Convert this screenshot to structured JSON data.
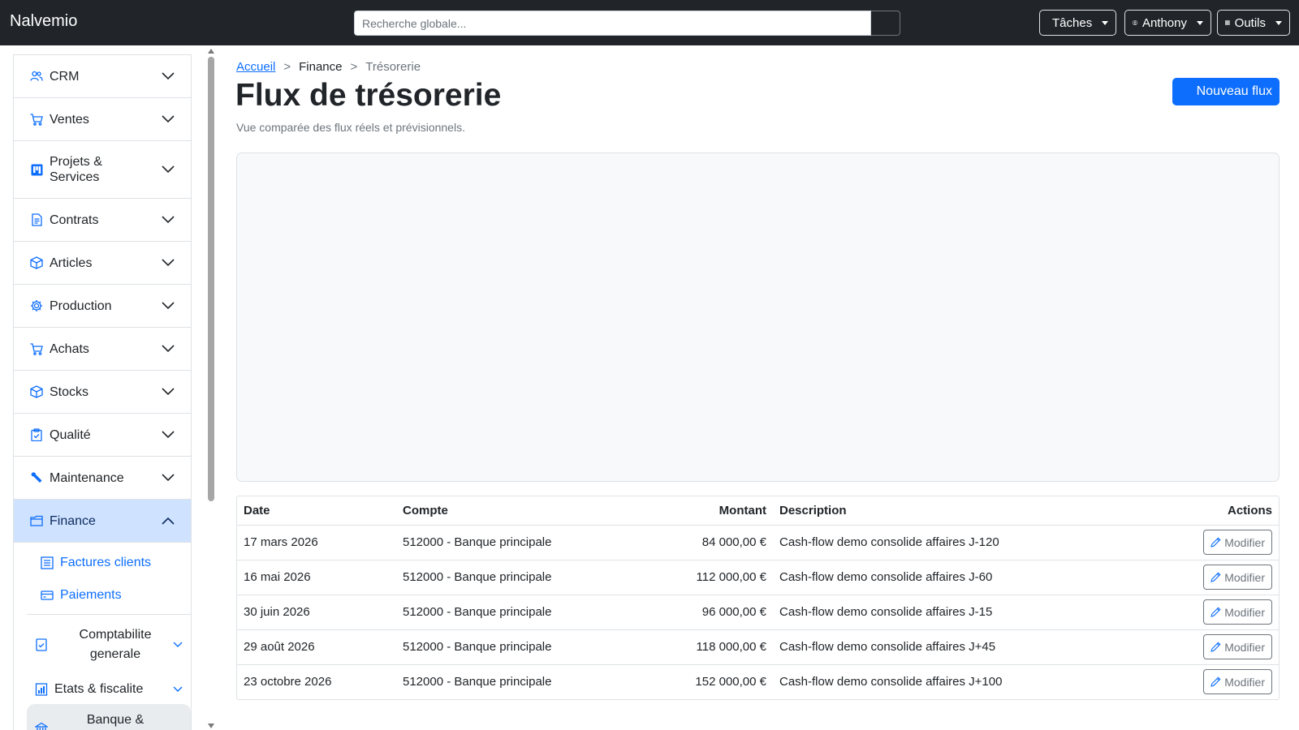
{
  "app": {
    "brand": "Nalvemio"
  },
  "search": {
    "placeholder": "Recherche globale..."
  },
  "topnav": {
    "tasks": {
      "label": "Tâches",
      "icon": "list-icon"
    },
    "user": {
      "label": "Anthony",
      "icon": "user-circle-icon"
    },
    "tools": {
      "label": "Outils",
      "icon": "grid-icon"
    }
  },
  "sidebar": {
    "items": [
      {
        "label": "CRM",
        "icon": "people-icon"
      },
      {
        "label": "Ventes",
        "icon": "cart-icon"
      },
      {
        "label": "Projets & Services",
        "icon": "kanban-icon"
      },
      {
        "label": "Contrats",
        "icon": "document-icon"
      },
      {
        "label": "Articles",
        "icon": "box-icon"
      },
      {
        "label": "Production",
        "icon": "gear-icon"
      },
      {
        "label": "Achats",
        "icon": "cart-icon"
      },
      {
        "label": "Stocks",
        "icon": "box-icon"
      },
      {
        "label": "Qualité",
        "icon": "clipboard-check-icon"
      },
      {
        "label": "Maintenance",
        "icon": "wrench-icon"
      },
      {
        "label": "Finance",
        "icon": "folder-icon"
      }
    ],
    "finance_sub": [
      {
        "label": "Factures clients",
        "icon": "list-icon"
      },
      {
        "label": "Paiements",
        "icon": "credit-card-icon"
      }
    ],
    "finance_groups": [
      {
        "label": "Comptabilite generale",
        "icon": "journal-check-icon"
      },
      {
        "label": "Etats & fiscalite",
        "icon": "bar-chart-icon"
      },
      {
        "label": "Banque &",
        "icon": "bank-icon"
      }
    ]
  },
  "breadcrumb": {
    "home": "Accueil",
    "section": "Finance",
    "current": "Trésorerie",
    "separator": ">"
  },
  "page": {
    "title": "Flux de trésorerie",
    "subtitle": "Vue comparée des flux réels et prévisionnels.",
    "new_button": "Nouveau flux"
  },
  "table": {
    "headers": {
      "date": "Date",
      "account": "Compte",
      "amount": "Montant",
      "description": "Description",
      "actions": "Actions"
    },
    "edit_label": "Modifier",
    "rows": [
      {
        "date": "17 mars 2026",
        "account": "512000 - Banque principale",
        "amount": "84 000,00 €",
        "description": "Cash-flow demo consolide affaires J-120"
      },
      {
        "date": "16 mai 2026",
        "account": "512000 - Banque principale",
        "amount": "112 000,00 €",
        "description": "Cash-flow demo consolide affaires J-60"
      },
      {
        "date": "30 juin 2026",
        "account": "512000 - Banque principale",
        "amount": "96 000,00 €",
        "description": "Cash-flow demo consolide affaires J-15"
      },
      {
        "date": "29 août 2026",
        "account": "512000 - Banque principale",
        "amount": "118 000,00 €",
        "description": "Cash-flow demo consolide affaires J+45"
      },
      {
        "date": "23 octobre 2026",
        "account": "512000 - Banque principale",
        "amount": "152 000,00 €",
        "description": "Cash-flow demo consolide affaires J+100"
      }
    ]
  },
  "colors": {
    "primary": "#0d6efd",
    "topbar": "#212529",
    "active_bg": "#cfe2ff"
  }
}
